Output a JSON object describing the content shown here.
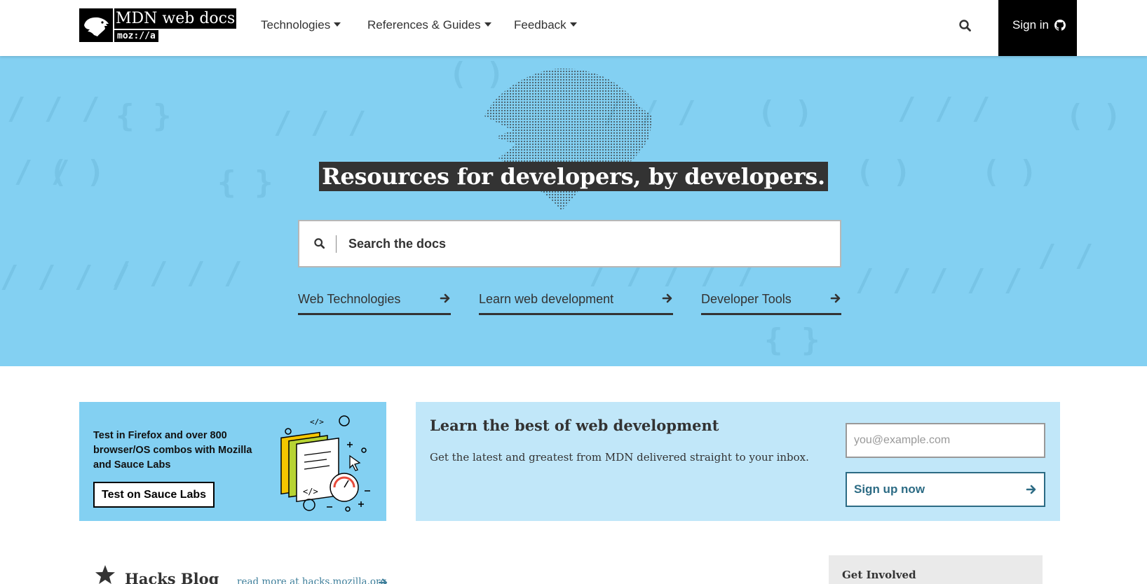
{
  "header": {
    "logo_title": "MDN web docs",
    "logo_subtitle": "moz://a",
    "nav": [
      {
        "label": "Technologies"
      },
      {
        "label": "References & Guides"
      },
      {
        "label": "Feedback"
      }
    ],
    "signin_label": "Sign in",
    "icons": {
      "search": "search-icon",
      "github": "github-icon",
      "dropdown": "caret-down-icon"
    }
  },
  "hero": {
    "title": "Resources for developers, by developers.",
    "search_placeholder": "Search the docs",
    "links": [
      {
        "label": "Web Technologies"
      },
      {
        "label": "Learn web development"
      },
      {
        "label": "Developer Tools"
      }
    ],
    "colors": {
      "background": "#83d0f2",
      "title_bg": "#333333"
    }
  },
  "promo": {
    "text": "Test in Firefox and over 800 browser/OS combos with Mozilla and Sauce Labs",
    "button_label": "Test on Sauce Labs"
  },
  "newsletter": {
    "title": "Learn the best of web development",
    "description": "Get the latest and greatest from MDN delivered straight to your inbox.",
    "email_placeholder": "you@example.com",
    "button_label": "Sign up now",
    "colors": {
      "background": "#c1e7f9",
      "button": "#2c6b84"
    }
  },
  "hacks": {
    "title": "Hacks Blog",
    "link": "read more at hacks.mozilla.org"
  },
  "involved": {
    "title": "Get Involved"
  }
}
